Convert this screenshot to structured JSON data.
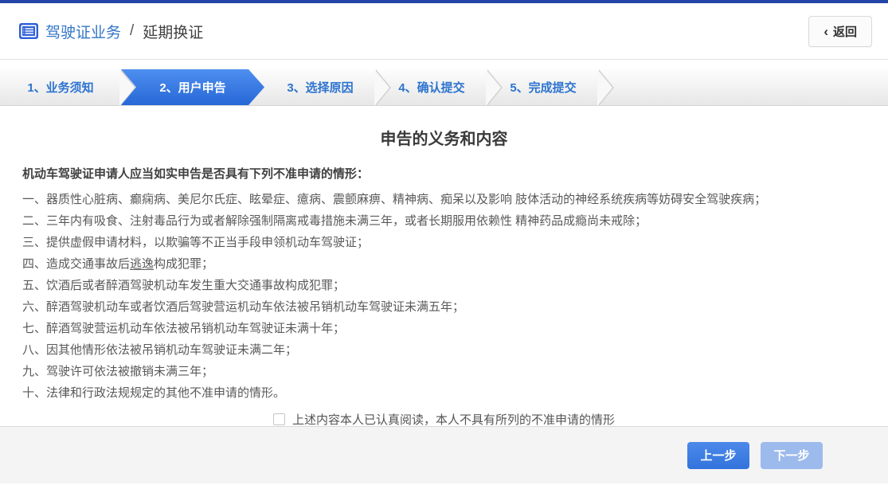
{
  "header": {
    "breadcrumb_primary": "驾驶证业务",
    "breadcrumb_separator": "/",
    "breadcrumb_secondary": "延期换证",
    "back_chevron": "‹",
    "back_label": "返回"
  },
  "steps": [
    {
      "label": "1、业务须知",
      "active": false
    },
    {
      "label": "2、用户申告",
      "active": true
    },
    {
      "label": "3、选择原因",
      "active": false
    },
    {
      "label": "4、确认提交",
      "active": false
    },
    {
      "label": "5、完成提交",
      "active": false
    }
  ],
  "declaration": {
    "title": "申告的义务和内容",
    "intro": "机动车驾驶证申请人应当如实申告是否具有下列不准申请的情形：",
    "items": [
      "一、器质性心脏病、癫痫病、美尼尔氏症、眩晕症、癔病、震颤麻痹、精神病、痴呆以及影响 肢体活动的神经系统疾病等妨碍安全驾驶疾病；",
      "二、三年内有吸食、注射毒品行为或者解除强制隔离戒毒措施未满三年，或者长期服用依赖性 精神药品成瘾尚未戒除；",
      "三、提供虚假申请材料，以欺骗等不正当手段申领机动车驾驶证；",
      "四、造成交通事故后逃逸构成犯罪；",
      "五、饮酒后或者醉酒驾驶机动车发生重大交通事故构成犯罪；",
      "六、醉酒驾驶机动车或者饮酒后驾驶营运机动车依法被吊销机动车驾驶证未满五年；",
      "七、醉酒驾驶营运机动车依法被吊销机动车驾驶证未满十年；",
      "八、因其他情形依法被吊销机动车驾驶证未满二年；",
      "九、驾驶许可依法被撤销未满三年；",
      "十、法律和行政法规规定的其他不准申请的情形。"
    ],
    "underlined_term": "逃逸",
    "agree_label": "上述内容本人已认真阅读，本人不具有所列的不准申请的情形",
    "agree_checked": false
  },
  "footer": {
    "prev_label": "上一步",
    "next_label": "下一步",
    "next_enabled": false
  },
  "colors": {
    "top_border_blue": "#2344a7",
    "accent_blue": "#3376c8",
    "step_text_blue": "#2d74cf",
    "active_step_blue": "#2f73de",
    "primary_button_blue": "#3c7de2",
    "disabled_button_blue": "#9cbaec",
    "footer_background": "#f4f4f4",
    "body_text": "#595959"
  }
}
